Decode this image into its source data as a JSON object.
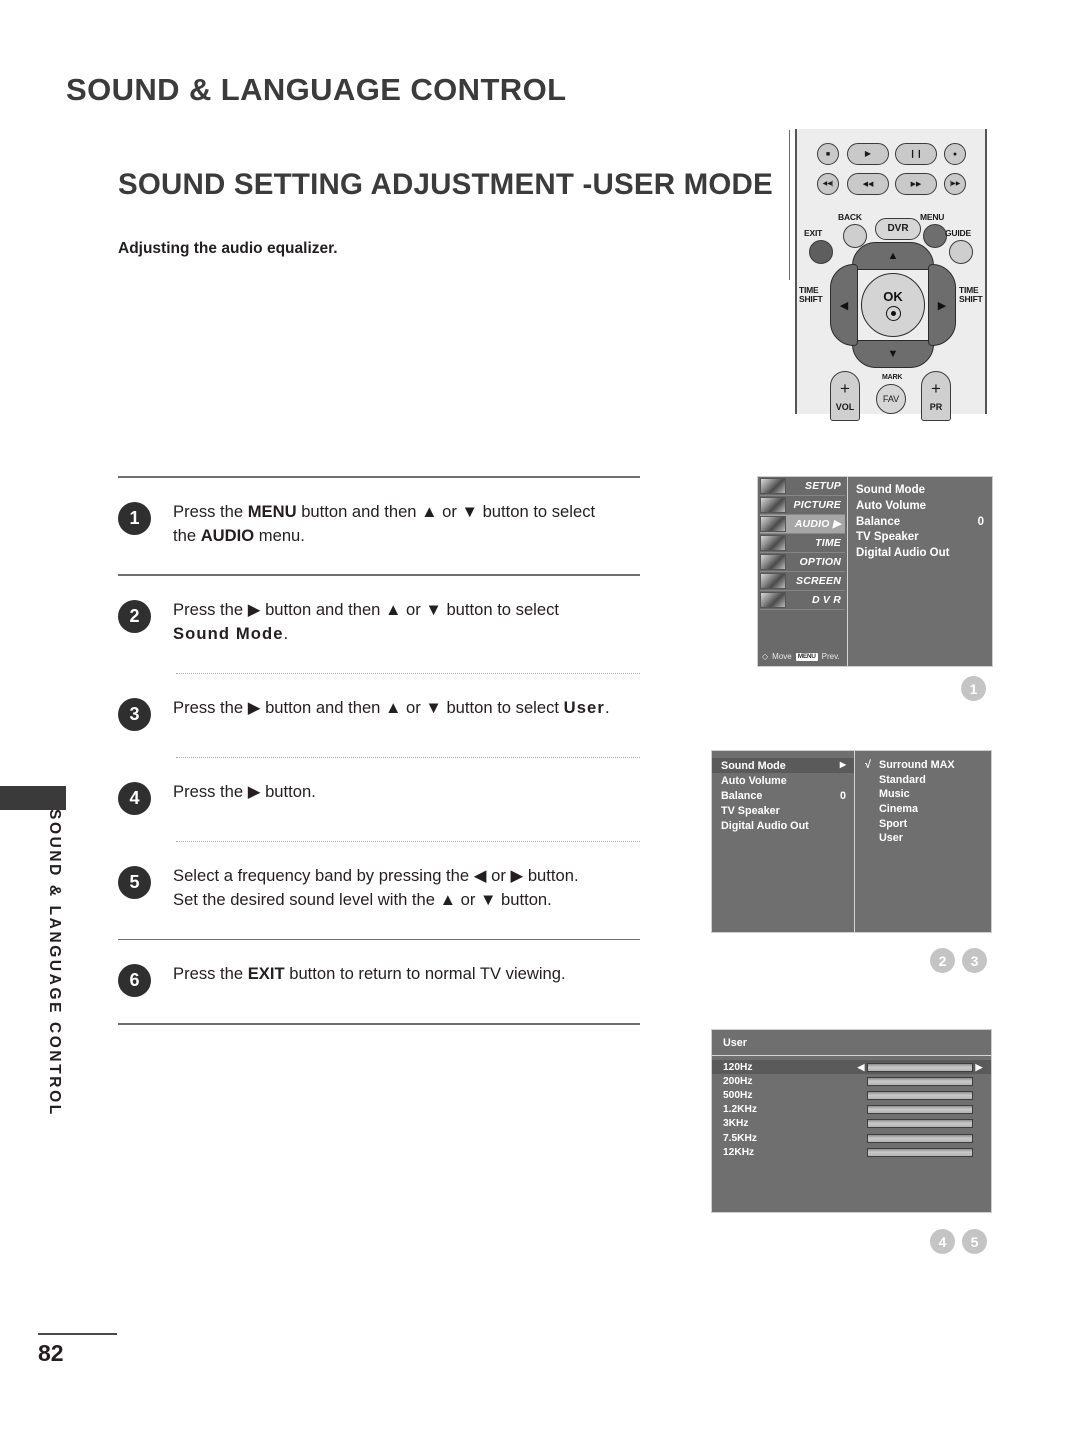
{
  "page": {
    "chapter_title": "SOUND & LANGUAGE CONTROL",
    "section_title": "SOUND SETTING ADJUSTMENT -USER MODE",
    "subtitle": "Adjusting the audio equalizer.",
    "side_tab_text": "SOUND & LANGUAGE CONTROL",
    "page_number": "82"
  },
  "remote": {
    "transport_row1": [
      "stop-icon",
      "play-icon",
      "pause-icon",
      "record-icon"
    ],
    "transport_row2": [
      "skip-back-icon",
      "rewind-icon",
      "fast-forward-icon",
      "skip-forward-icon"
    ],
    "glyphs": {
      "stop": "■",
      "play": "▶",
      "pause": "❙❙",
      "record": "●",
      "skip_back": "◀◀|",
      "rewind": "◀◀",
      "fast_forward": "▶▶",
      "skip_forward": "|▶▶",
      "up": "▲",
      "down": "▼",
      "left": "◀",
      "right": "▶",
      "plus": "+"
    },
    "labels": {
      "back": "BACK",
      "dvr": "DVR",
      "menu": "MENU",
      "exit": "EXIT",
      "guide": "GUIDE",
      "time_shift_left": "TIME\nSHIFT",
      "time_shift_right": "TIME\nSHIFT",
      "ok": "OK",
      "mark": "MARK",
      "fav": "FAV",
      "vol": "VOL",
      "pr": "PR"
    }
  },
  "steps": [
    {
      "number": "1",
      "html": "Press the <b>MENU</b> button and then ▲ or ▼ button to select<br>the <b>AUDIO</b> menu."
    },
    {
      "number": "2",
      "html": "Press the ▶ button and then ▲ or ▼ button to select<br><span class=\"sp\">Sound Mode</span>."
    },
    {
      "number": "3",
      "html": "Press the ▶ button and then ▲ or ▼ button to select <span class=\"sp\">User</span>."
    },
    {
      "number": "4",
      "html": "Press the ▶ button."
    },
    {
      "number": "5",
      "html": "Select a frequency band by pressing the ◀ or ▶ button.<br>Set the desired sound level with the ▲ or ▼ button."
    },
    {
      "number": "6",
      "html": "Press the <b>EXIT</b> button to return to normal TV viewing."
    }
  ],
  "osd_menu": {
    "categories": [
      {
        "label": "SETUP",
        "selected": false
      },
      {
        "label": "PICTURE",
        "selected": false
      },
      {
        "label": "AUDIO ▶",
        "selected": true
      },
      {
        "label": "TIME",
        "selected": false
      },
      {
        "label": "OPTION",
        "selected": false
      },
      {
        "label": "SCREEN",
        "selected": false
      },
      {
        "label": "D V R",
        "selected": false
      }
    ],
    "items": [
      {
        "label": "Sound Mode",
        "value": ""
      },
      {
        "label": "Auto Volume",
        "value": ""
      },
      {
        "label": "Balance",
        "value": "0"
      },
      {
        "label": "TV Speaker",
        "value": ""
      },
      {
        "label": "Digital Audio Out",
        "value": ""
      }
    ],
    "footer": {
      "move_icon": "◇",
      "move_label": "Move",
      "key_chip": "MENU",
      "prev_label": "Prev."
    },
    "callout": "1"
  },
  "osd_soundmode": {
    "items": [
      {
        "label": "Sound Mode",
        "value": "▶",
        "selected": true
      },
      {
        "label": "Auto Volume",
        "value": "",
        "selected": false
      },
      {
        "label": "Balance",
        "value": "0",
        "selected": false
      },
      {
        "label": "TV Speaker",
        "value": "",
        "selected": false
      },
      {
        "label": "Digital Audio Out",
        "value": "",
        "selected": false
      }
    ],
    "options": [
      {
        "label": "Surround MAX",
        "checked": "√"
      },
      {
        "label": "Standard",
        "checked": ""
      },
      {
        "label": "Music",
        "checked": ""
      },
      {
        "label": "Cinema",
        "checked": ""
      },
      {
        "label": "Sport",
        "checked": ""
      },
      {
        "label": "User",
        "checked": ""
      }
    ],
    "callouts": [
      "2",
      "3"
    ]
  },
  "osd_user_eq": {
    "header": "User",
    "bands": [
      {
        "label": "120Hz",
        "selected": true
      },
      {
        "label": "200Hz",
        "selected": false
      },
      {
        "label": "500Hz",
        "selected": false
      },
      {
        "label": "1.2KHz",
        "selected": false
      },
      {
        "label": "3KHz",
        "selected": false
      },
      {
        "label": "7.5KHz",
        "selected": false
      },
      {
        "label": "12KHz",
        "selected": false
      }
    ],
    "arrow_left": "◀",
    "arrow_right": "▶",
    "callouts": [
      "4",
      "5"
    ]
  }
}
